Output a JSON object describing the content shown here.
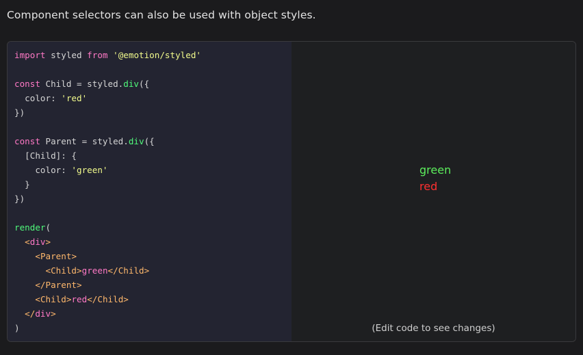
{
  "intro": "Component selectors can also be used with object styles.",
  "colors": {
    "background": "#1b1b1d",
    "editor_bg": "#232431",
    "keyword": "#ff79c6",
    "string": "#f1fa8c",
    "function": "#50fa7b",
    "tag_punct": "#ffb86c",
    "output_green": "#5cee5c",
    "output_red": "#ff3030"
  },
  "code": {
    "l1": {
      "kw1": "import",
      "id": " styled ",
      "kw2": "from",
      "sp": " ",
      "str": "'@emotion/styled'"
    },
    "l3": {
      "kw": "const",
      "rest": " Child = styled.",
      "fn": "div",
      "end": "({"
    },
    "l4": {
      "prop": "  color: ",
      "str": "'red'"
    },
    "l5": "})",
    "l7": {
      "kw": "const",
      "rest": " Parent = styled.",
      "fn": "div",
      "end": "({"
    },
    "l8": "  [Child]: {",
    "l9": {
      "prop": "    color: ",
      "str": "'green'"
    },
    "l10": "  }",
    "l11": "})",
    "l13": {
      "fn": "render",
      "end": "("
    },
    "l14": {
      "indent": "  ",
      "lt": "<",
      "tag": "div",
      "gt": ">"
    },
    "l15": {
      "indent": "    ",
      "lt": "<",
      "tag": "Parent",
      "gt": ">"
    },
    "l16": {
      "indent": "      ",
      "lt": "<",
      "tag": "Child",
      "gt": ">",
      "text": "green",
      "lt2": "</",
      "tag2": "Child",
      "gt2": ">"
    },
    "l17": {
      "indent": "    ",
      "lt": "</",
      "tag": "Parent",
      "gt": ">"
    },
    "l18": {
      "indent": "    ",
      "lt": "<",
      "tag": "Child",
      "gt": ">",
      "text": "red",
      "lt2": "</",
      "tag2": "Child",
      "gt2": ">"
    },
    "l19": {
      "indent": "  ",
      "lt": "</",
      "tag": "div",
      "gt": ">"
    },
    "l20": ")"
  },
  "preview": {
    "green_text": "green",
    "red_text": "red",
    "hint": "(Edit code to see changes)"
  }
}
